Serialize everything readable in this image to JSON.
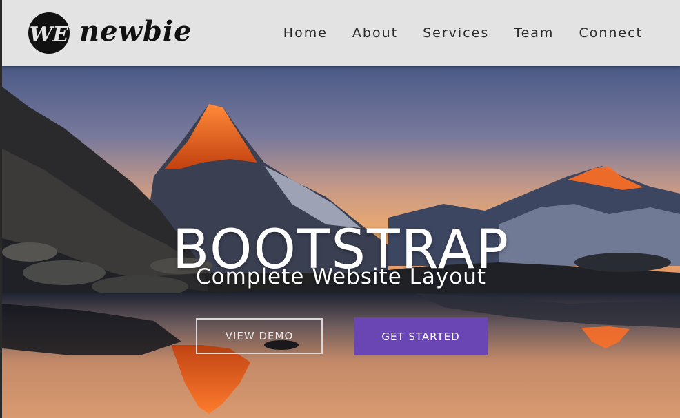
{
  "brand": {
    "logo_text": "WE",
    "name": "newbie"
  },
  "nav": {
    "items": [
      "Home",
      "About",
      "Services",
      "Team",
      "Connect"
    ]
  },
  "hero": {
    "title": "BOOTSTRAP",
    "subtitle": "Complete Website Layout",
    "buttons": {
      "view_demo": "VIEW DEMO",
      "get_started": "GET STARTED"
    }
  },
  "colors": {
    "navbar_bg": "#e3e3e3",
    "accent": "#6a46b4",
    "nav_text": "#2b2b2b"
  }
}
